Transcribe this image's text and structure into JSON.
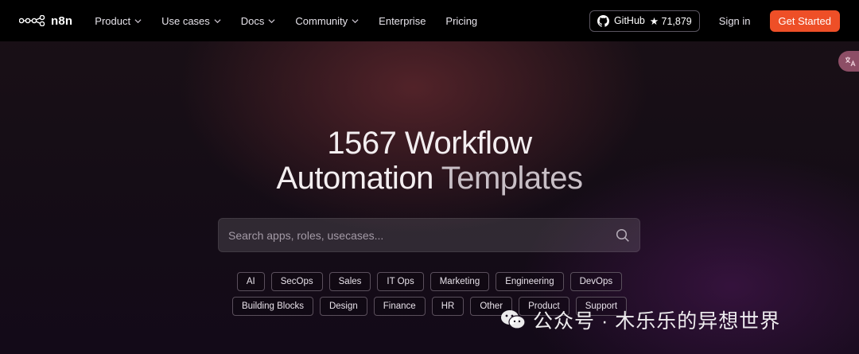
{
  "brand": {
    "name": "n8n"
  },
  "nav": {
    "items": [
      {
        "label": "Product",
        "has_dropdown": true
      },
      {
        "label": "Use cases",
        "has_dropdown": true
      },
      {
        "label": "Docs",
        "has_dropdown": true
      },
      {
        "label": "Community",
        "has_dropdown": true
      },
      {
        "label": "Enterprise",
        "has_dropdown": false
      },
      {
        "label": "Pricing",
        "has_dropdown": false
      }
    ],
    "github": {
      "label": "GitHub",
      "stars": "★ 71,879"
    },
    "signin": "Sign in",
    "cta": "Get Started"
  },
  "translate_tab": {
    "icon": "translate-icon"
  },
  "hero": {
    "line1_a": "1567 Workflow",
    "line2_a": "Automation",
    "line2_b": "Templates"
  },
  "search": {
    "placeholder": "Search apps, roles, usecases...",
    "value": ""
  },
  "categories": {
    "row1": [
      "AI",
      "SecOps",
      "Sales",
      "IT Ops",
      "Marketing",
      "Engineering",
      "DevOps"
    ],
    "row2": [
      "Building Blocks",
      "Design",
      "Finance",
      "HR",
      "Other",
      "Product",
      "Support"
    ]
  },
  "watermark": {
    "text": "公众号 · 木乐乐的异想世界"
  },
  "colors": {
    "cta": "#ee4f27",
    "nav_bg": "#000000"
  }
}
